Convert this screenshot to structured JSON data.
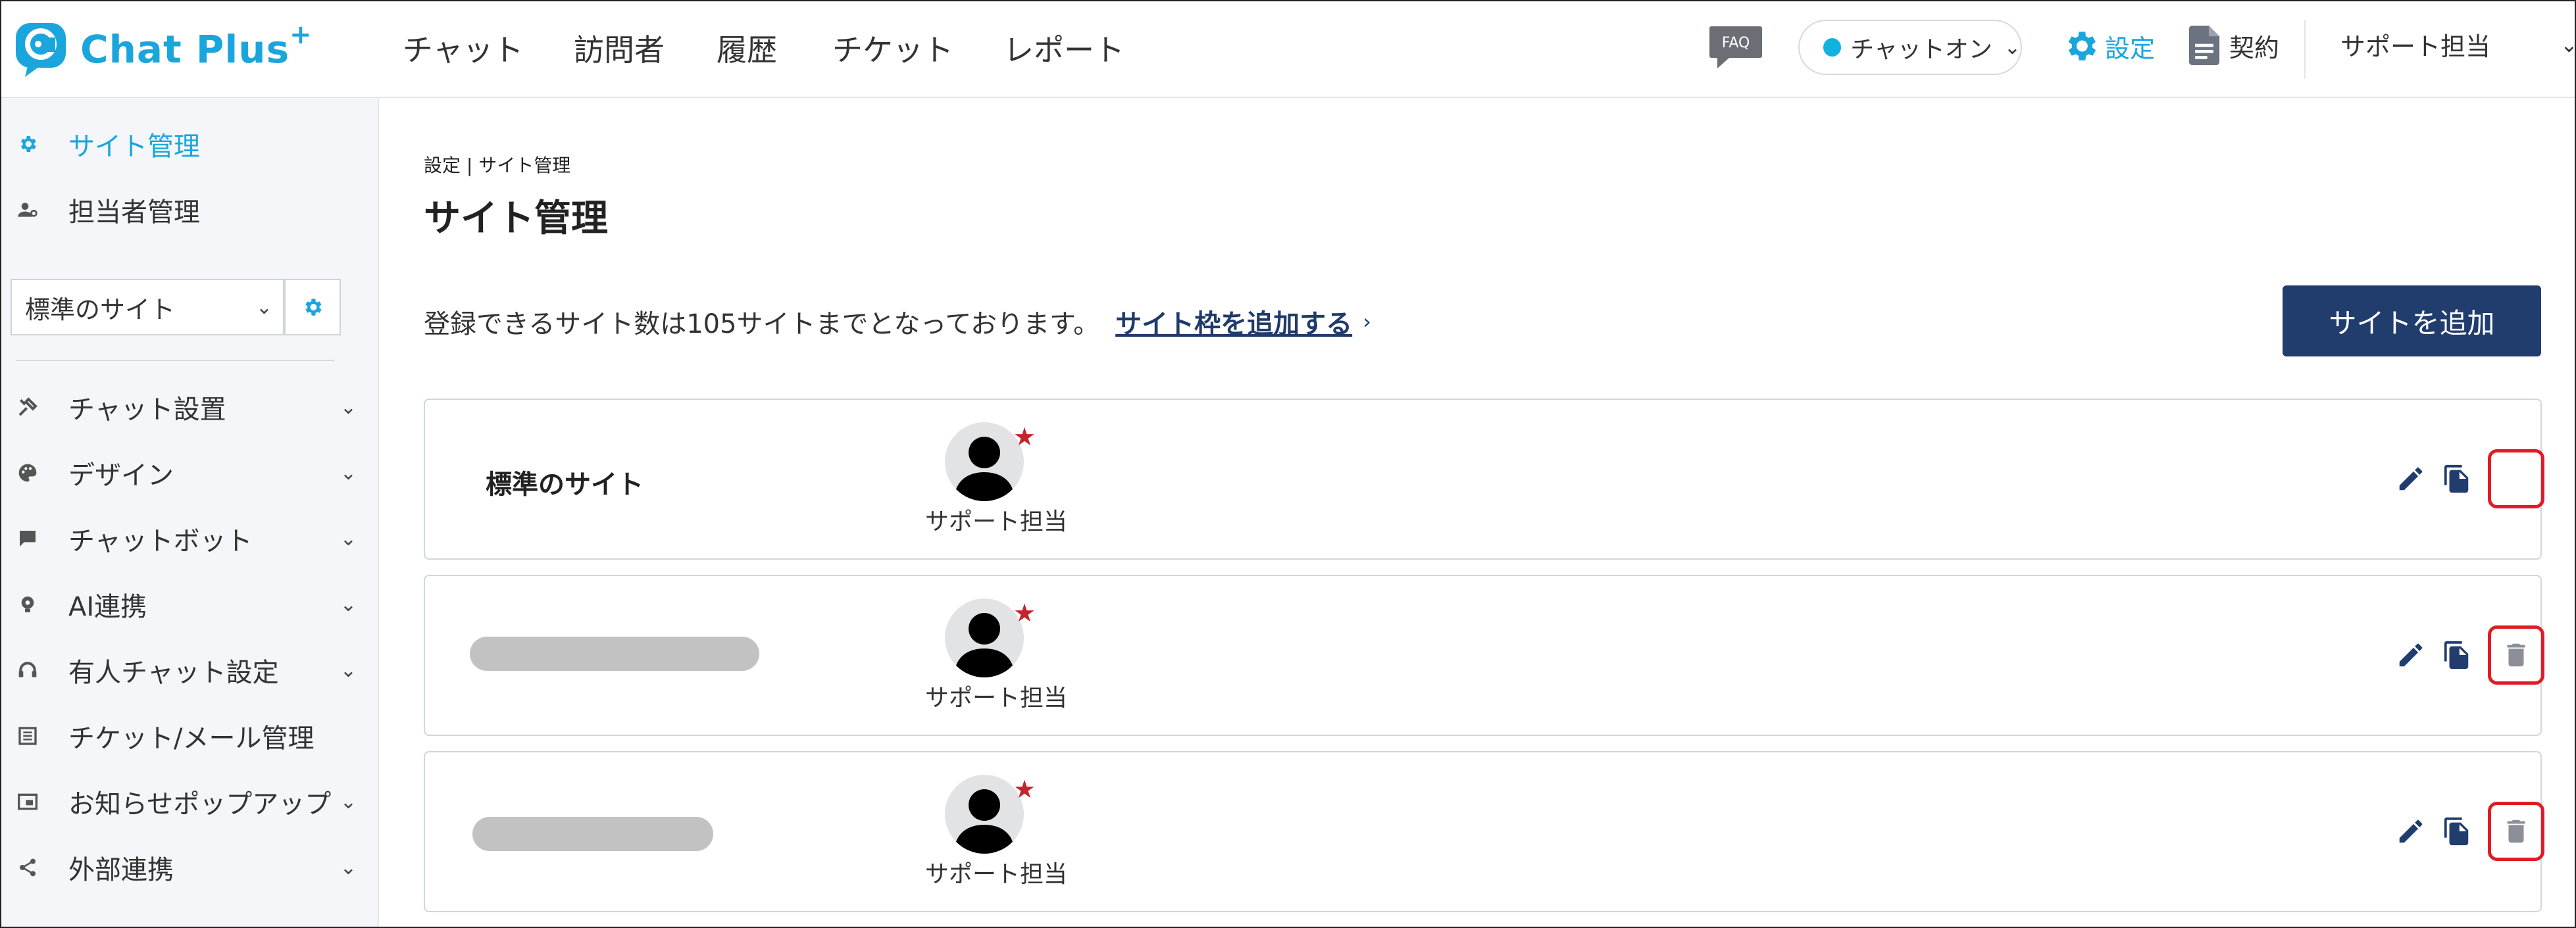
{
  "header": {
    "logo_text": "Chat Plus",
    "logo_plus": "+",
    "nav": [
      "チャット",
      "訪問者",
      "履歴",
      "チケット",
      "レポート"
    ],
    "faq_label": "FAQ",
    "status_label": "チャットオン",
    "settings_label": "設定",
    "contract_label": "契約",
    "user_label": "サポート担当"
  },
  "sidebar": {
    "top_items": [
      {
        "label": "サイト管理",
        "icon": "gear-icon",
        "active": true
      },
      {
        "label": "担当者管理",
        "icon": "user-gear-icon",
        "active": false
      }
    ],
    "site_select_label": "標準のサイト",
    "menu_items": [
      {
        "label": "チャット設置",
        "icon": "tools-icon",
        "expandable": true
      },
      {
        "label": "デザイン",
        "icon": "palette-icon",
        "expandable": true
      },
      {
        "label": "チャットボット",
        "icon": "chat-bubble-icon",
        "expandable": true
      },
      {
        "label": "AI連携",
        "icon": "ai-bulb-icon",
        "expandable": true
      },
      {
        "label": "有人チャット設定",
        "icon": "headset-icon",
        "expandable": true
      },
      {
        "label": "チケット/メール管理",
        "icon": "list-icon",
        "expandable": false
      },
      {
        "label": "お知らせポップアップ",
        "icon": "popup-icon",
        "expandable": true
      },
      {
        "label": "外部連携",
        "icon": "share-icon",
        "expandable": true
      }
    ]
  },
  "main": {
    "breadcrumb": [
      "設定",
      "サイト管理"
    ],
    "title": "サイト管理",
    "info_text": "登録できるサイト数は105サイトまでとなっております。",
    "add_frame_link": "サイト枠を追加する",
    "add_site_button": "サイトを追加",
    "sites": [
      {
        "name": "標準のサイト",
        "name_hidden": false,
        "agent": "サポート担当",
        "deletable": false
      },
      {
        "name": "",
        "name_hidden": true,
        "agent": "サポート担当",
        "deletable": true
      },
      {
        "name": "",
        "name_hidden": true,
        "agent": "サポート担当",
        "deletable": true
      }
    ]
  },
  "colors": {
    "brand": "#1aa6dc",
    "primary_button": "#213d6e",
    "highlight_box": "#e01b24",
    "star": "#c0262c",
    "action_icon": "#213d6e"
  }
}
